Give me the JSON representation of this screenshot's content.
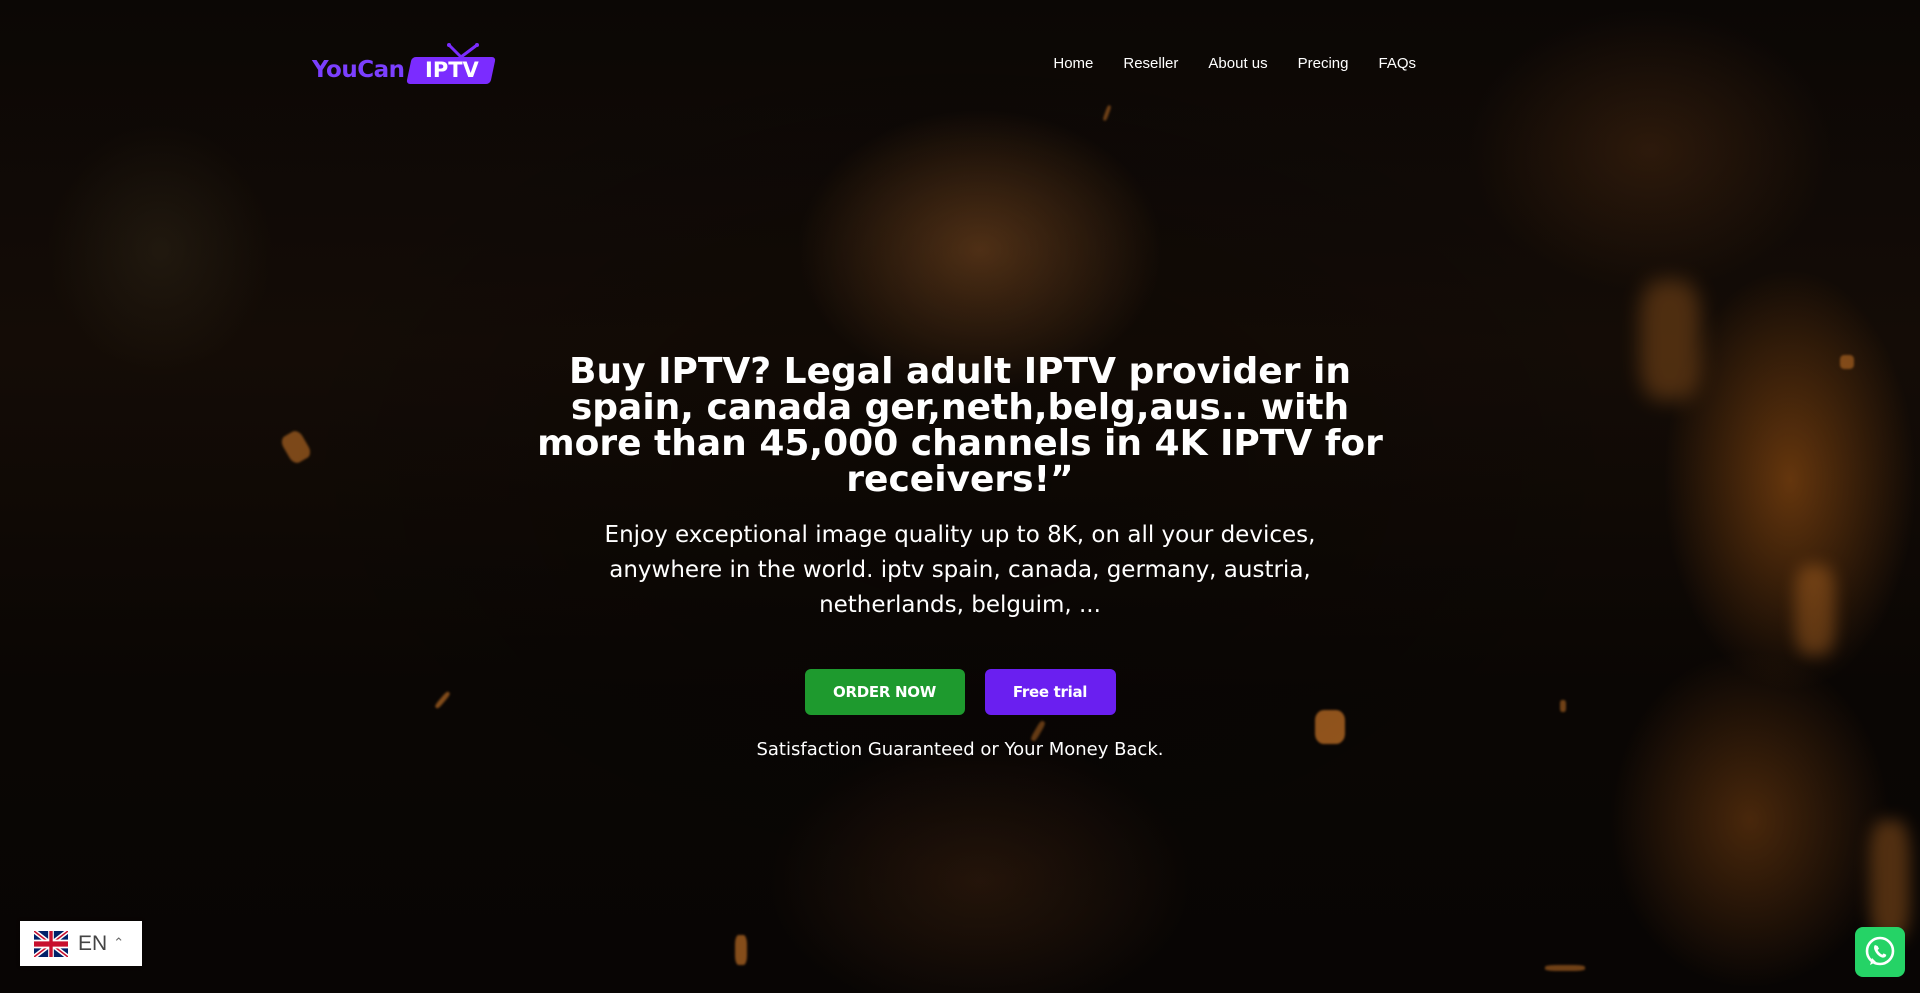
{
  "brand": {
    "name_part1": "YouCan",
    "name_part2": "IPTV"
  },
  "nav": {
    "items": [
      "Home",
      "Reseller",
      "About us",
      "Precing",
      "FAQs"
    ]
  },
  "hero": {
    "headline": "Buy IPTV? Legal adult IPTV provider in spain, canada ger,neth,belg,aus.. with more than 45,000 channels in 4K IPTV for receivers!”",
    "subtext": "Enjoy exceptional image quality up to 8K, on all your devices, anywhere in the world. iptv spain, canada, germany, austria, netherlands, belguim, ...",
    "order_button": "ORDER NOW",
    "trial_button": "Free trial",
    "guarantee": "Satisfaction Guaranteed or Your Money Back."
  },
  "language": {
    "code": "EN",
    "flag": "uk-flag-icon"
  },
  "whatsapp": {
    "icon": "whatsapp-icon"
  },
  "colors": {
    "brand_purple": "#7b2cff",
    "order_green": "#1e9a2e",
    "trial_purple": "#6a1ff0",
    "whatsapp_green": "#25d366"
  }
}
